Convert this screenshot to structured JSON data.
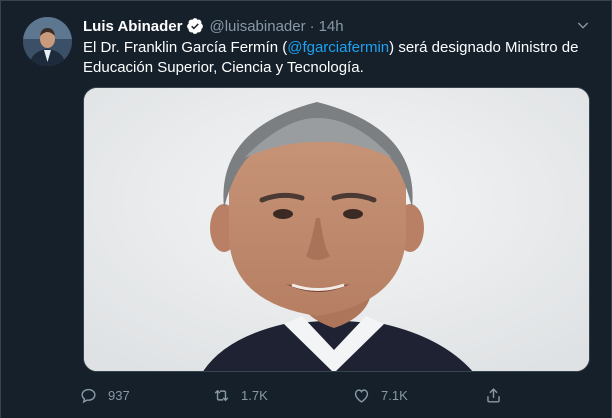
{
  "tweet": {
    "author": {
      "display_name": "Luis Abinader",
      "handle": "@luisabinader",
      "verified": true
    },
    "separator": "·",
    "timestamp": "14h",
    "text": {
      "before_mention": "El Dr. Franklin García Fermín (",
      "mention": "@fgarciafermin",
      "after_mention": ") será designado Ministro de Educación Superior, Ciencia y Tecnología."
    },
    "media": {
      "type": "photo"
    },
    "actions": {
      "replies": "937",
      "retweets": "1.7K",
      "likes": "7.1K"
    }
  },
  "colors": {
    "background": "#15202b",
    "text_primary": "#ffffff",
    "text_secondary": "#8899a6",
    "accent": "#1da1f2",
    "border": "#38444d"
  },
  "icons": {
    "verified": "verified-badge-icon",
    "caret": "chevron-down-icon",
    "reply": "reply-icon",
    "retweet": "retweet-icon",
    "like": "heart-icon",
    "share": "share-icon"
  }
}
